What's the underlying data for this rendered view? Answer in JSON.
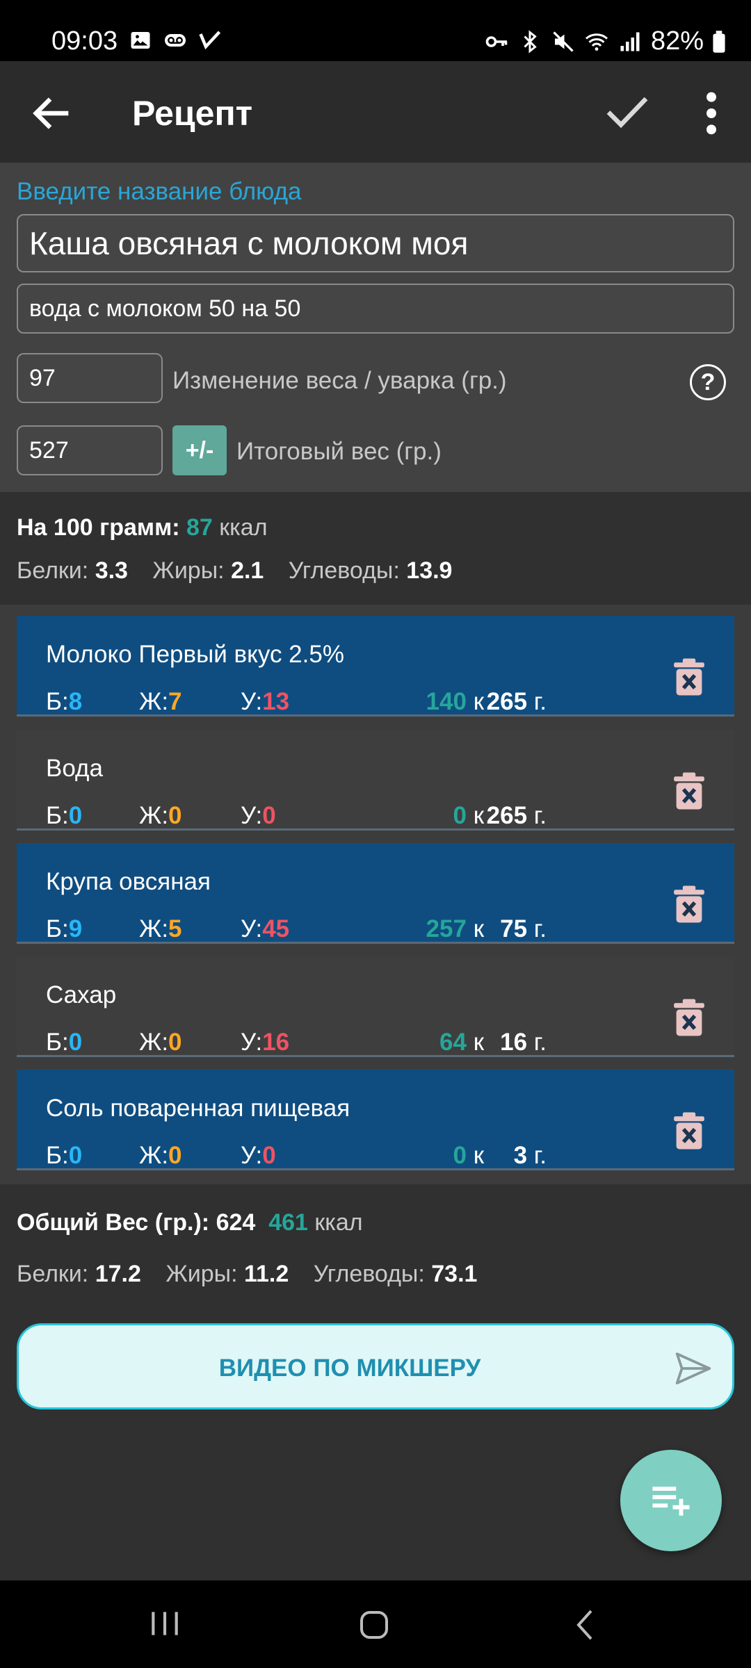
{
  "status_bar": {
    "time": "09:03",
    "battery": "82%",
    "icons": [
      "gallery-icon",
      "voicemail-icon",
      "app-icon",
      "key-icon",
      "bluetooth-icon",
      "mute-icon",
      "wifi-icon",
      "signal-icon",
      "battery-icon"
    ]
  },
  "app_bar": {
    "title": "Рецепт",
    "back_icon": "arrow-left-icon",
    "confirm_icon": "check-icon",
    "menu_icon": "more-vert-icon"
  },
  "form": {
    "hint": "Введите название блюда",
    "dish_name": "Каша овсяная с молоком моя",
    "description": "вода с молоком 50 на 50",
    "weight_change_value": "97",
    "weight_change_label": "Изменение веса / уварка (гр.)",
    "help_label": "?",
    "total_weight_value": "527",
    "plus_minus_label": "+/-",
    "total_weight_label": "Итоговый вес (гр.)"
  },
  "per_100": {
    "label": "На 100 грамм:",
    "kcal": "87",
    "kcal_unit": "ккал",
    "protein_label": "Белки:",
    "protein": "3.3",
    "fat_label": "Жиры:",
    "fat": "2.1",
    "carbs_label": "Углеводы:",
    "carbs": "13.9"
  },
  "ingredient_labels": {
    "protein": "Б:",
    "fat": "Ж:",
    "carbs": "У:",
    "kcal_unit": "к",
    "weight_unit": "г."
  },
  "ingredients": [
    {
      "name": "Молоко Первый вкус 2.5%",
      "protein": "8",
      "fat": "7",
      "carbs": "13",
      "kcal": "140",
      "weight": "265"
    },
    {
      "name": "Вода",
      "protein": "0",
      "fat": "0",
      "carbs": "0",
      "kcal": "0",
      "weight": "265"
    },
    {
      "name": "Крупа овсяная",
      "protein": "9",
      "fat": "5",
      "carbs": "45",
      "kcal": "257",
      "weight": "75"
    },
    {
      "name": "Сахар",
      "protein": "0",
      "fat": "0",
      "carbs": "16",
      "kcal": "64",
      "weight": "16"
    },
    {
      "name": "Соль поваренная пищевая",
      "protein": "0",
      "fat": "0",
      "carbs": "0",
      "kcal": "0",
      "weight": "3"
    }
  ],
  "totals": {
    "label": "Общий Вес (гр.):",
    "weight": "624",
    "kcal": "461",
    "kcal_unit": "ккал",
    "protein_label": "Белки:",
    "protein": "17.2",
    "fat_label": "Жиры:",
    "fat": "11.2",
    "carbs_label": "Углеводы:",
    "carbs": "73.1"
  },
  "video_button": {
    "label": "ВИДЕО ПО МИКШЕРУ",
    "icon": "send-icon"
  },
  "fab": {
    "icon": "playlist-add-icon"
  },
  "nav_bar": {
    "icons": [
      "recents-icon",
      "home-icon",
      "back-icon"
    ]
  },
  "colors": {
    "accent_teal": "#26a69a",
    "protein": "#29b6f6",
    "fat": "#ffa726",
    "carbs": "#ef5363",
    "item_blue": "#0f4d80"
  }
}
